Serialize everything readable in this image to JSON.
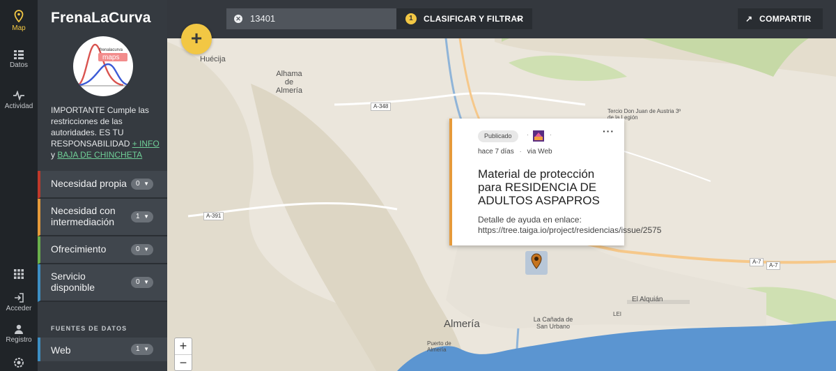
{
  "rail": {
    "map": "Map",
    "datos": "Datos",
    "actividad": "Actividad",
    "acceder": "Acceder",
    "registro": "Registro"
  },
  "sidebar": {
    "brand": "FrenaLaCurva",
    "logo_small": "frenalacurva",
    "logo_big": "maps",
    "notice_text": "IMPORTANTE Cumple las restricciones de las autoridades. ES TU RESPONSABILIDAD",
    "info_link": "+ INFO",
    "and": "y",
    "unpin_link": "BAJA DE CHINCHETA",
    "categories": [
      {
        "label": "Necesidad propia",
        "count": "0",
        "color": "#c0392b"
      },
      {
        "label": "Necesidad con intermediación",
        "count": "1",
        "color": "#e69a3a"
      },
      {
        "label": "Ofrecimiento",
        "count": "0",
        "color": "#6ab04c"
      },
      {
        "label": "Servicio disponible",
        "count": "0",
        "color": "#3d8fc4"
      }
    ],
    "sources_heading": "FUENTES DE DATOS",
    "sources": [
      {
        "label": "Web",
        "count": "1"
      }
    ]
  },
  "topbar": {
    "search_value": "13401",
    "filter_count": "1",
    "filter_label": "CLASIFICAR Y FILTRAR",
    "share_label": "COMPARTIR"
  },
  "map": {
    "places": [
      {
        "name": "Huécija"
      },
      {
        "name": "Alhama de Almería"
      },
      {
        "name": "Tercio Don Juan de Austria 3º de la Legión"
      },
      {
        "name": "Almería"
      },
      {
        "name": "El Alquián"
      },
      {
        "name": "La Cañada de San Urbano"
      },
      {
        "name": "Puerto de Almería"
      },
      {
        "name": "LEI"
      }
    ],
    "roads": [
      "A-348",
      "A-391",
      "A-7",
      "A-7"
    ],
    "zoom_in": "+",
    "zoom_out": "−"
  },
  "card": {
    "status": "Publicado",
    "sep": "·",
    "more": "···",
    "time": "hace 7 días",
    "via": "via Web",
    "title": "Material de protección para RESIDENCIA DE ADULTOS ASPAPROS",
    "desc_label": "Detalle de ayuda en enlace:",
    "desc_link": "https://tree.taiga.io/project/residencias/issue/2575",
    "accent": "#e69a3a"
  }
}
